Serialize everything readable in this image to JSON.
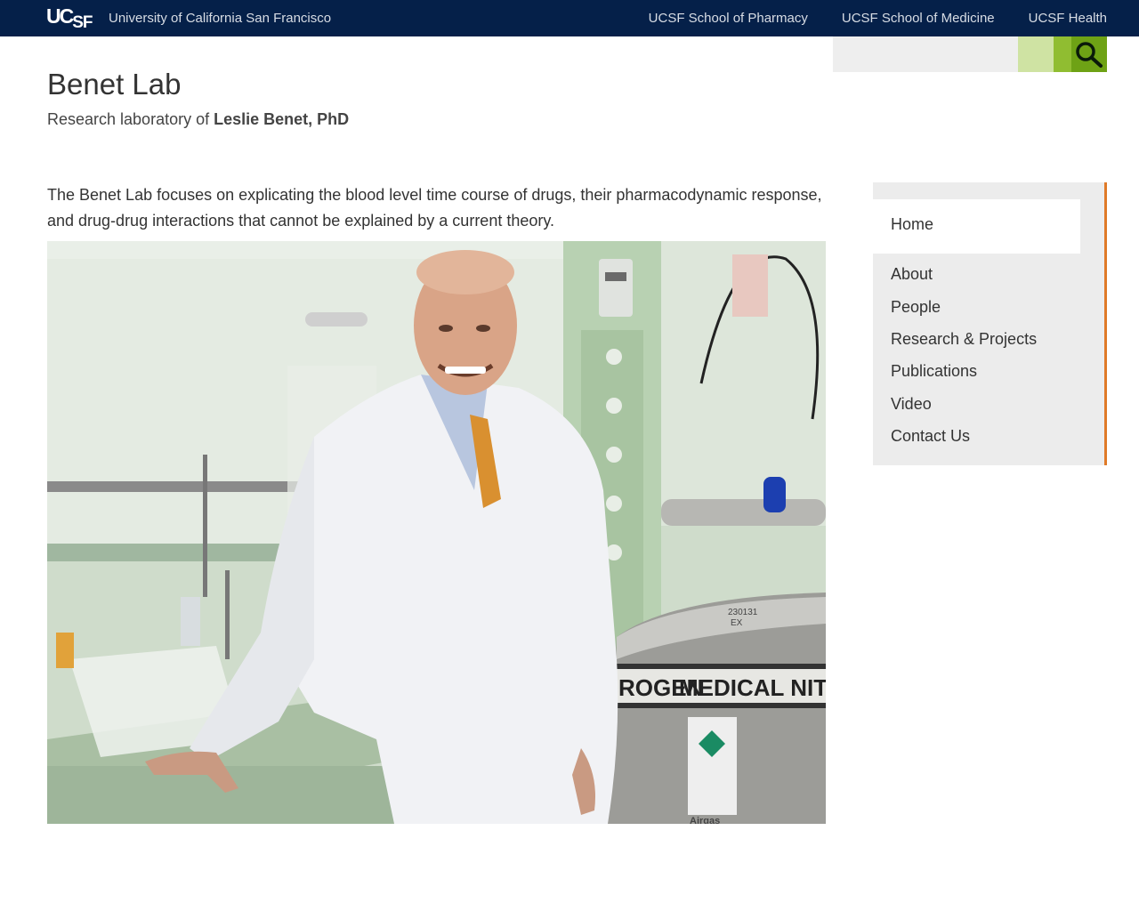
{
  "topbar": {
    "logo_main": "UC",
    "logo_sub": "SF",
    "university": "University of California San Francisco",
    "links": [
      "UCSF School of Pharmacy",
      "UCSF School of Medicine",
      "UCSF Health"
    ]
  },
  "search": {
    "placeholder": ""
  },
  "site": {
    "title": "Benet Lab",
    "subtitle_prefix": "Research laboratory of ",
    "subtitle_name": "Leslie Benet, PhD"
  },
  "intro": "The Benet Lab focuses on explicating the blood level time course of drugs, their pharmacodynamic response, and drug-drug interactions that cannot be explained by a current theory.",
  "photo": {
    "tank_label": "MEDICAL NITROGEN",
    "tank_label_left": "ROGEN",
    "tank_number": "230131",
    "tank_sub": "EX",
    "brand": "Airgas"
  },
  "sidebar": {
    "items": [
      {
        "label": "Home"
      },
      {
        "label": "About"
      },
      {
        "label": "People"
      },
      {
        "label": "Research & Projects"
      },
      {
        "label": "Publications"
      },
      {
        "label": "Video"
      },
      {
        "label": "Contact Us"
      }
    ]
  },
  "colors": {
    "topbar": "#052049",
    "accent": "#e07a28",
    "search_green": "#6ea215"
  }
}
